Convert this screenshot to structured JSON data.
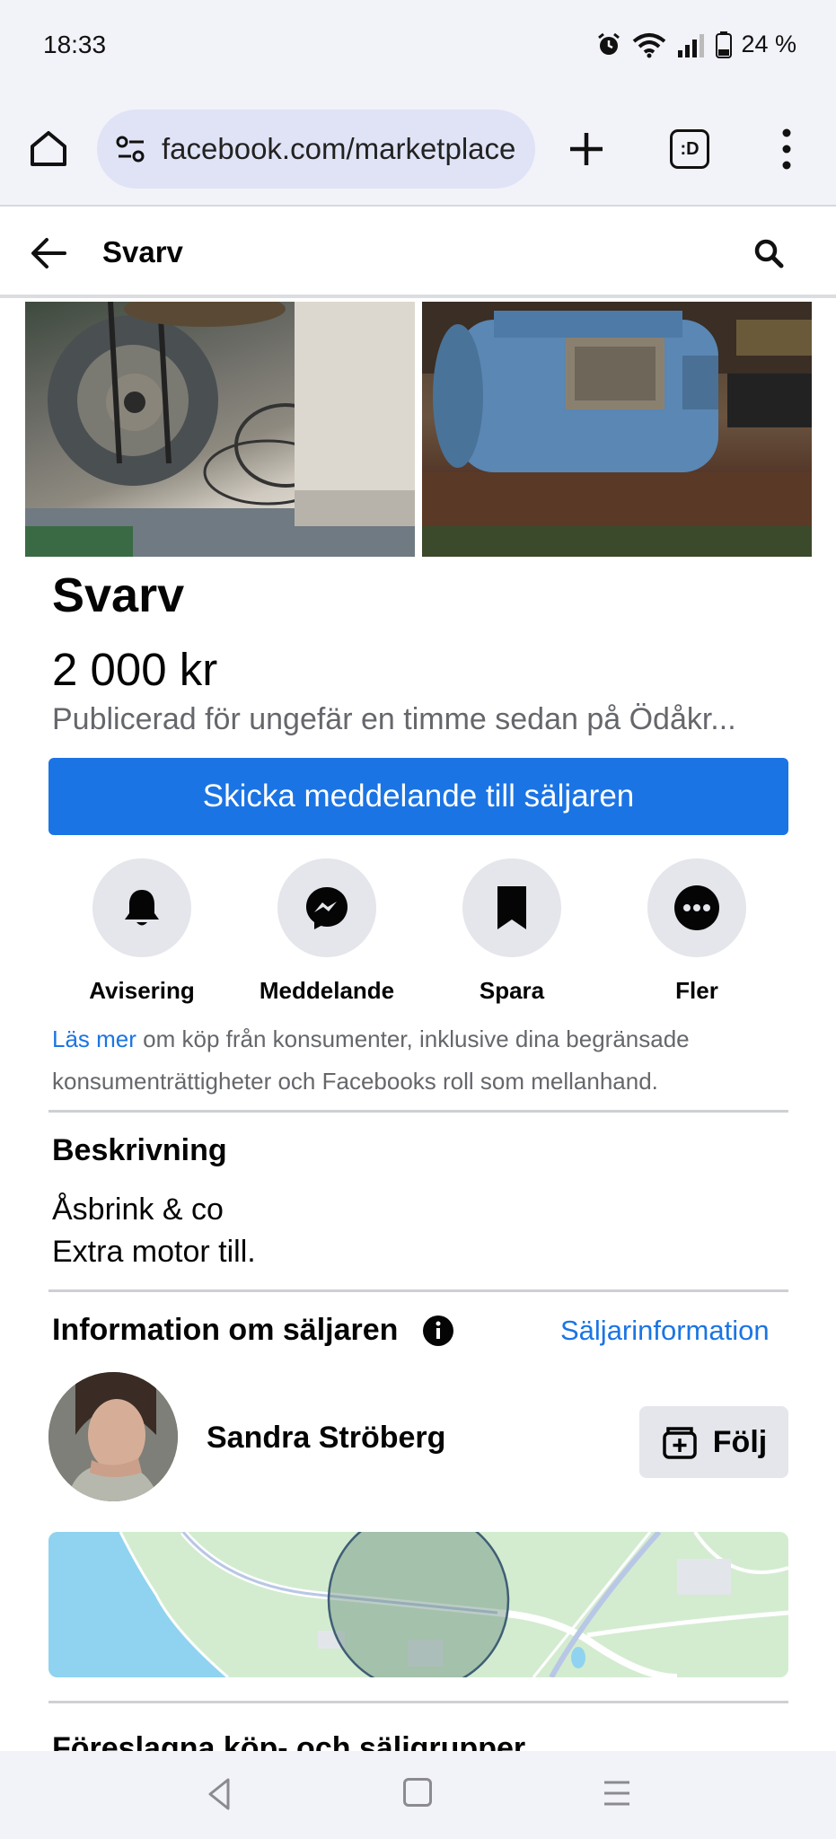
{
  "status_bar": {
    "time": "18:33",
    "battery": "24 %",
    "icons": [
      "alarm-icon",
      "wifi-icon",
      "signal-icon",
      "battery-icon"
    ]
  },
  "browser": {
    "url": "facebook.com/marketplace",
    "tabs_label": ":D"
  },
  "header": {
    "title": "Svarv"
  },
  "listing": {
    "title": "Svarv",
    "price": "2 000 kr",
    "posted": "Publicerad för ungefär en timme sedan på Ödåkr...",
    "cta_label": "Skicka meddelande till säljaren"
  },
  "actions": [
    {
      "label": "Avisering",
      "icon": "bell-icon"
    },
    {
      "label": "Meddelande",
      "icon": "messenger-icon"
    },
    {
      "label": "Spara",
      "icon": "bookmark-icon"
    },
    {
      "label": "Fler",
      "icon": "more-icon"
    }
  ],
  "legal": {
    "link": "Läs mer",
    "text": " om köp från konsumenter, inklusive dina begränsade konsumenträttigheter och Facebooks roll som mellanhand."
  },
  "description": {
    "heading": "Beskrivning",
    "lines": [
      "Åsbrink & co",
      "Extra motor till."
    ]
  },
  "seller": {
    "heading": "Information om säljaren",
    "info_link": "Säljarinformation",
    "name": "Sandra Ströberg",
    "follow_label": "Följ"
  },
  "suggested": {
    "heading": "Föreslagna köp- och säljgrupper"
  },
  "colors": {
    "accent": "#1b74e4",
    "secondary_text": "#65676b",
    "button_gray": "#e4e6eb",
    "chrome_bg": "#f2f2f9"
  }
}
